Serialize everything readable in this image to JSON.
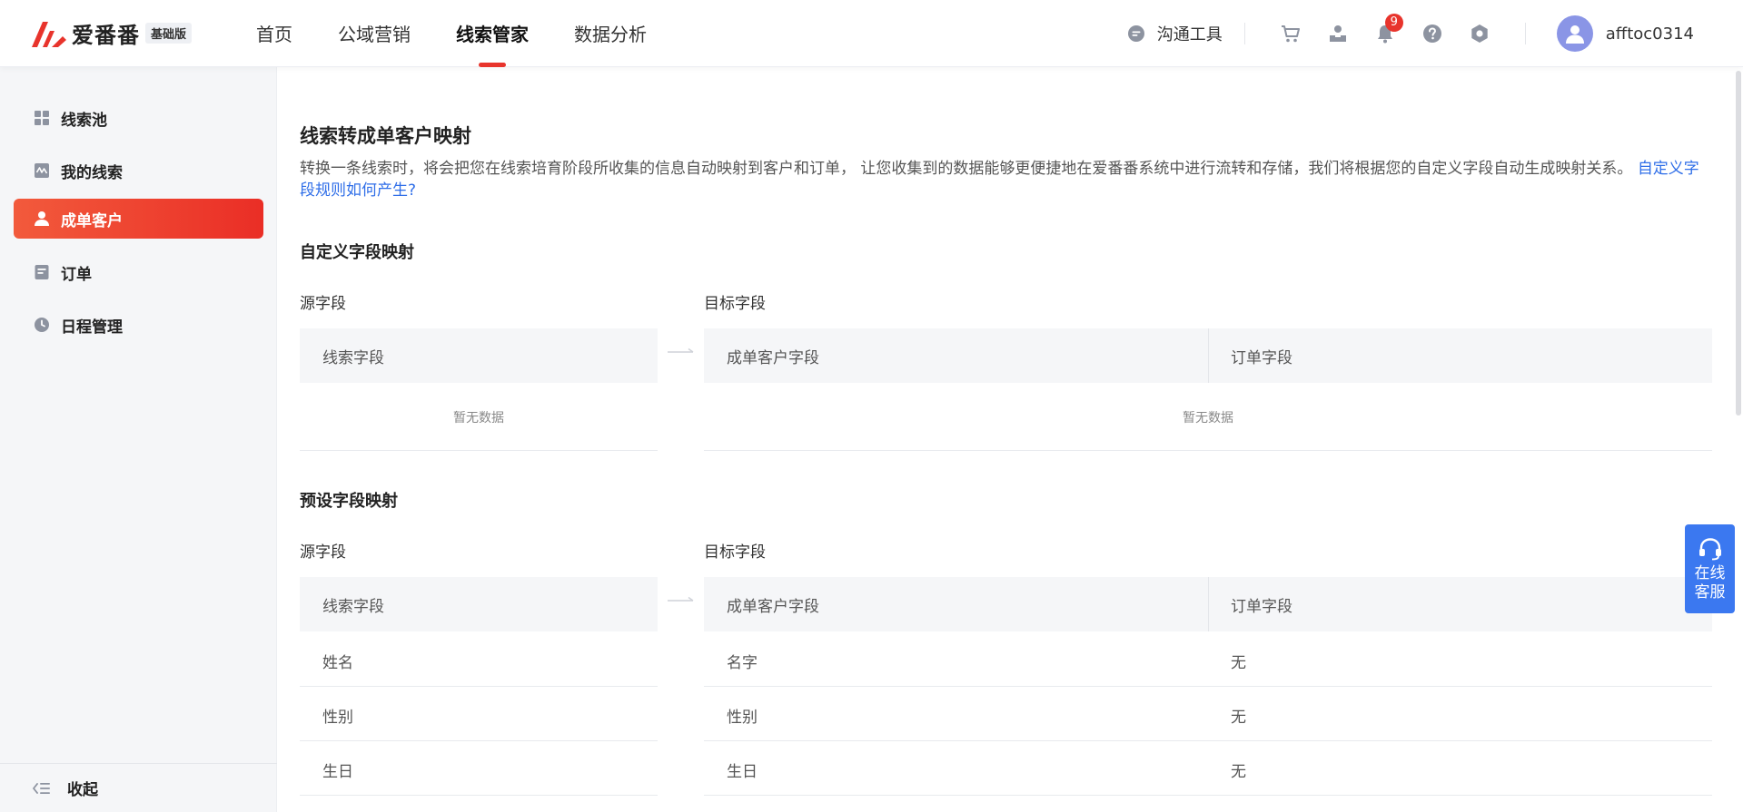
{
  "brand": {
    "name": "爱番番",
    "edition": "基础版",
    "accent": "#e8342c",
    "link_color": "#2f6ee8"
  },
  "nav": {
    "items": [
      {
        "label": "首页",
        "active": false
      },
      {
        "label": "公域营销",
        "active": false
      },
      {
        "label": "线索管家",
        "active": true
      },
      {
        "label": "数据分析",
        "active": false
      }
    ]
  },
  "header": {
    "tool_label": "沟通工具",
    "icons": [
      "cart-icon",
      "inbox-icon",
      "bell-icon",
      "help-icon",
      "settings-icon"
    ],
    "notification_count": "9",
    "username": "afftoc0314"
  },
  "sidebar": {
    "items": [
      {
        "label": "线索池",
        "icon": "grid-icon",
        "active": false
      },
      {
        "label": "我的线索",
        "icon": "trend-icon",
        "active": false
      },
      {
        "label": "成单客户",
        "icon": "user-icon",
        "active": true
      },
      {
        "label": "订单",
        "icon": "document-icon",
        "active": false
      },
      {
        "label": "日程管理",
        "icon": "clock-icon",
        "active": false
      }
    ],
    "collapse_label": "收起"
  },
  "main": {
    "title": "线索转成单客户映射",
    "description": "转换一条线索时，将会把您在线索培育阶段所收集的信息自动映射到客户和订单， 让您收集到的数据能够更便捷地在爱番番系统中进行流转和存储，我们将根据您的自定义字段自动生成映射关系。",
    "description_link": "自定义字段规则如何产生?",
    "custom_section": {
      "title": "自定义字段映射",
      "source_label": "源字段",
      "target_label": "目标字段",
      "source_header": "线索字段",
      "target_headers": [
        "成单客户字段",
        "订单字段"
      ],
      "empty_text": "暂无数据"
    },
    "preset_section": {
      "title": "预设字段映射",
      "source_label": "源字段",
      "target_label": "目标字段",
      "source_header": "线索字段",
      "target_headers": [
        "成单客户字段",
        "订单字段"
      ],
      "rows": [
        {
          "source": "姓名",
          "customer": "名字",
          "order": "无"
        },
        {
          "source": "性别",
          "customer": "性别",
          "order": "无"
        },
        {
          "source": "生日",
          "customer": "生日",
          "order": "无"
        }
      ]
    }
  },
  "customer_service": {
    "line1": "在线",
    "line2": "客服"
  }
}
